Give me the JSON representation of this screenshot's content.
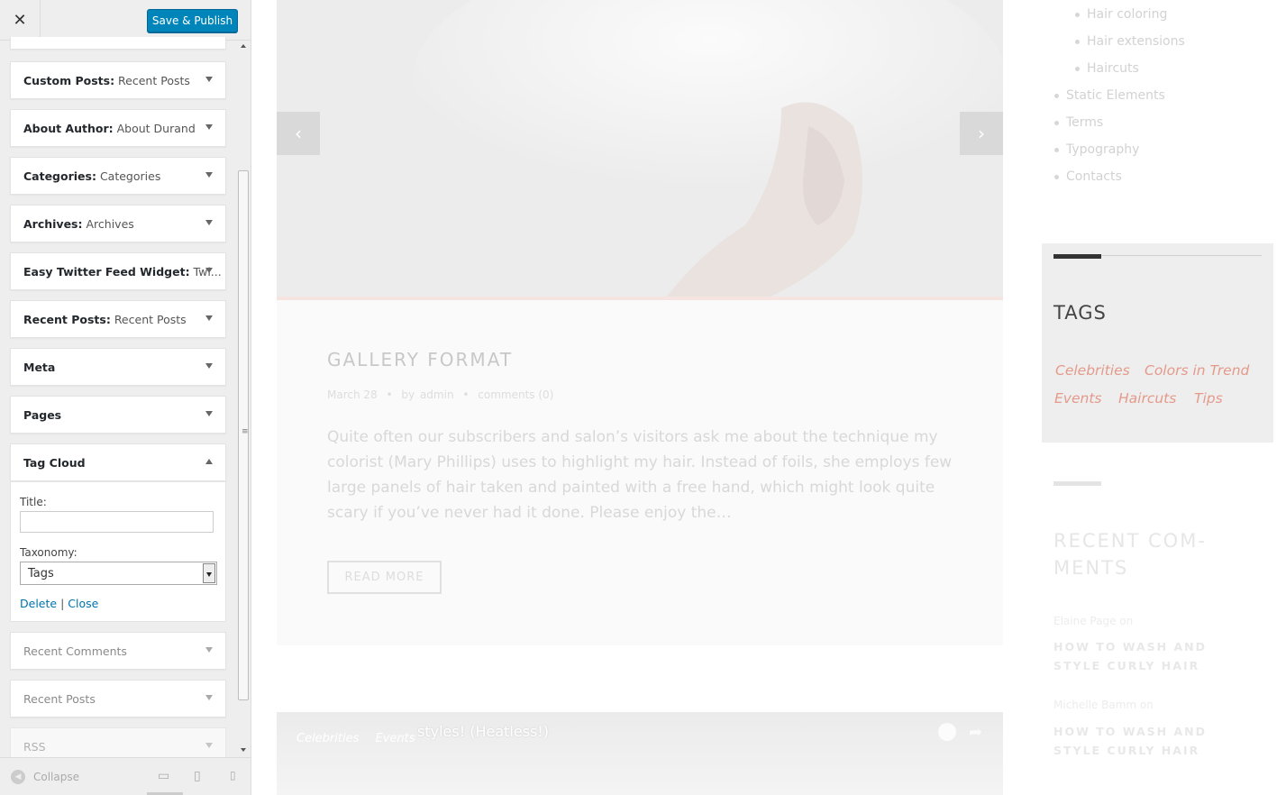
{
  "customizer": {
    "close_icon": "close-icon",
    "save_label": "Save & Publish",
    "widgets": [
      {
        "name": "Custom Posts",
        "title": "Recent Posts"
      },
      {
        "name": "About Author",
        "title": "About Durand"
      },
      {
        "name": "Categories",
        "title": "Categories"
      },
      {
        "name": "Archives",
        "title": "Archives"
      },
      {
        "name": "Easy Twitter Feed Widget",
        "title": "Twi..."
      },
      {
        "name": "Recent Posts",
        "title": "Recent Posts"
      },
      {
        "name": "Meta",
        "title": ""
      },
      {
        "name": "Pages",
        "title": ""
      },
      {
        "name": "Tag Cloud",
        "title": ""
      }
    ],
    "tag_cloud_form": {
      "title_label": "Title:",
      "title_value": "",
      "taxonomy_label": "Taxonomy:",
      "taxonomy_value": "Tags",
      "delete_link": "Delete",
      "separator": "|",
      "close_link": "Close"
    },
    "available_widgets": [
      "Recent Comments",
      "Recent Posts",
      "RSS"
    ],
    "footer": {
      "collapse_label": "Collapse",
      "devices": [
        "desktop-icon",
        "tablet-icon",
        "mobile-icon"
      ]
    }
  },
  "preview": {
    "slider": {
      "prev_icon": "chevron-left-icon",
      "next_icon": "chevron-right-icon"
    },
    "nav": {
      "sub_items": [
        "Hair coloring",
        "Hair extensions",
        "Haircuts"
      ],
      "items": [
        "Static Elements",
        "Terms",
        "Typography",
        "Contacts"
      ]
    },
    "post": {
      "title": "GALLERY FORMAT",
      "date": "March 28",
      "by": "by",
      "author": "admin",
      "comments": "comments (0)",
      "excerpt": "Quite often our subscribers and salon’s visitors ask me about the technique my colorist (Mary Phillips) uses to highlight my hair. Instead of foils, she employs few large panels of hair taken and painted with a free hand, which might look quite scary if you’ve never had it done. Please enjoy the…",
      "read_more": "READ MORE"
    },
    "video": {
      "title": "styles! (Heatless!)",
      "tags": [
        "Celebrities",
        "Events"
      ]
    },
    "tags_widget": {
      "title": "TAGS",
      "tags": [
        "Celebrities",
        "Colors in Trend",
        "Events",
        "Haircuts",
        "Tips"
      ]
    },
    "recent_comments": {
      "title": "RECENT COM-MENTS",
      "title_line1": "RECENT COM-",
      "title_line2": "MENTS",
      "items": [
        {
          "author": "Elaine Page on",
          "post": "HOW TO WASH AND STYLE CURLY HAIR"
        },
        {
          "author": "Michelle Bamm on",
          "post": "HOW TO WASH AND STYLE CURLY HAIR"
        }
      ]
    },
    "colors": {
      "accent": "#e49a8a",
      "button": "#0085ba",
      "link": "#0073aa"
    }
  }
}
